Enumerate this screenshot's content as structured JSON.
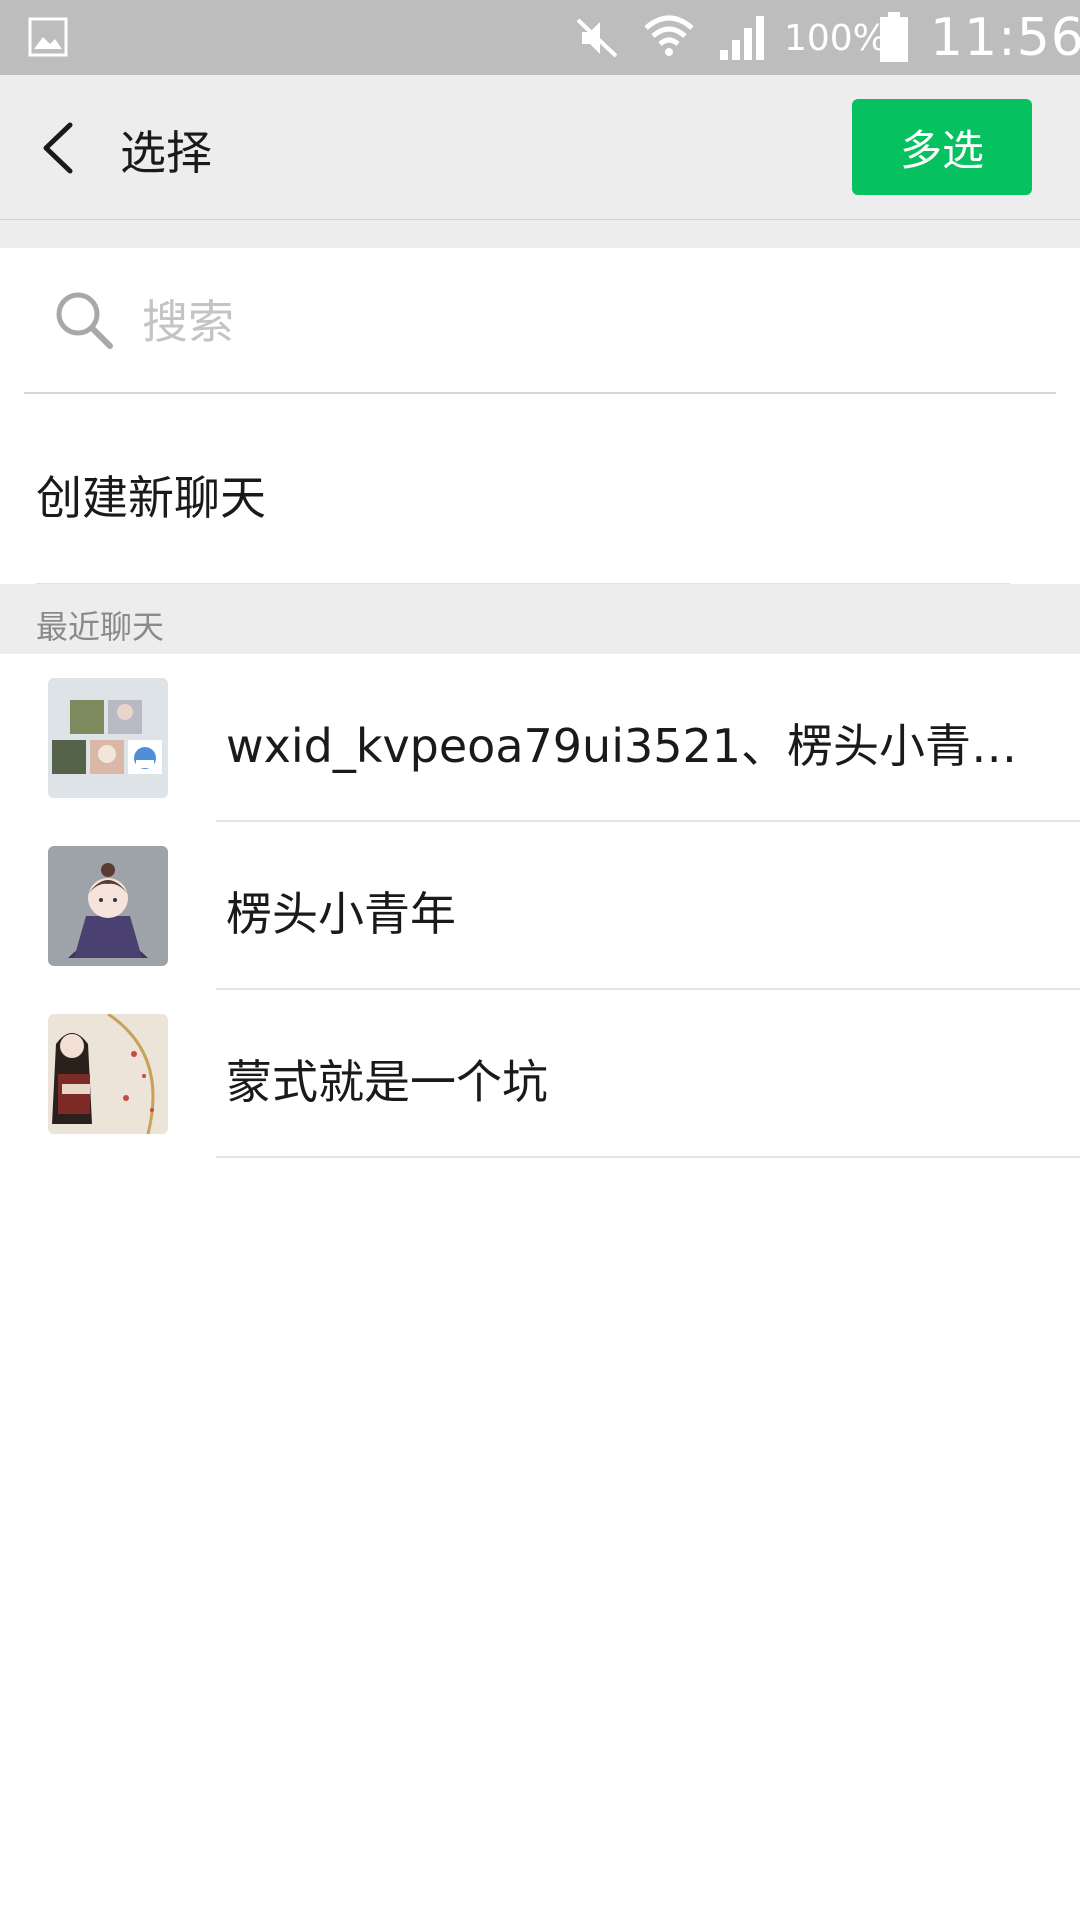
{
  "status_bar": {
    "battery_percent": "100%",
    "time": "11:56"
  },
  "appbar": {
    "title": "选择",
    "multi_select_label": "多选"
  },
  "search": {
    "placeholder": "搜索",
    "value": ""
  },
  "new_chat": {
    "label": "创建新聊天"
  },
  "recent": {
    "header": "最近聊天",
    "items": [
      {
        "name": "wxid_kvpeoa79ui3521、楞头小青年…",
        "avatar": "group-avatar"
      },
      {
        "name": "楞头小青年",
        "avatar": "user-avatar"
      },
      {
        "name": "蒙式就是一个坑",
        "avatar": "user-avatar"
      }
    ]
  },
  "colors": {
    "accent": "#07c160",
    "status_bar": "#bdbdbd",
    "appbar": "#ededed"
  }
}
